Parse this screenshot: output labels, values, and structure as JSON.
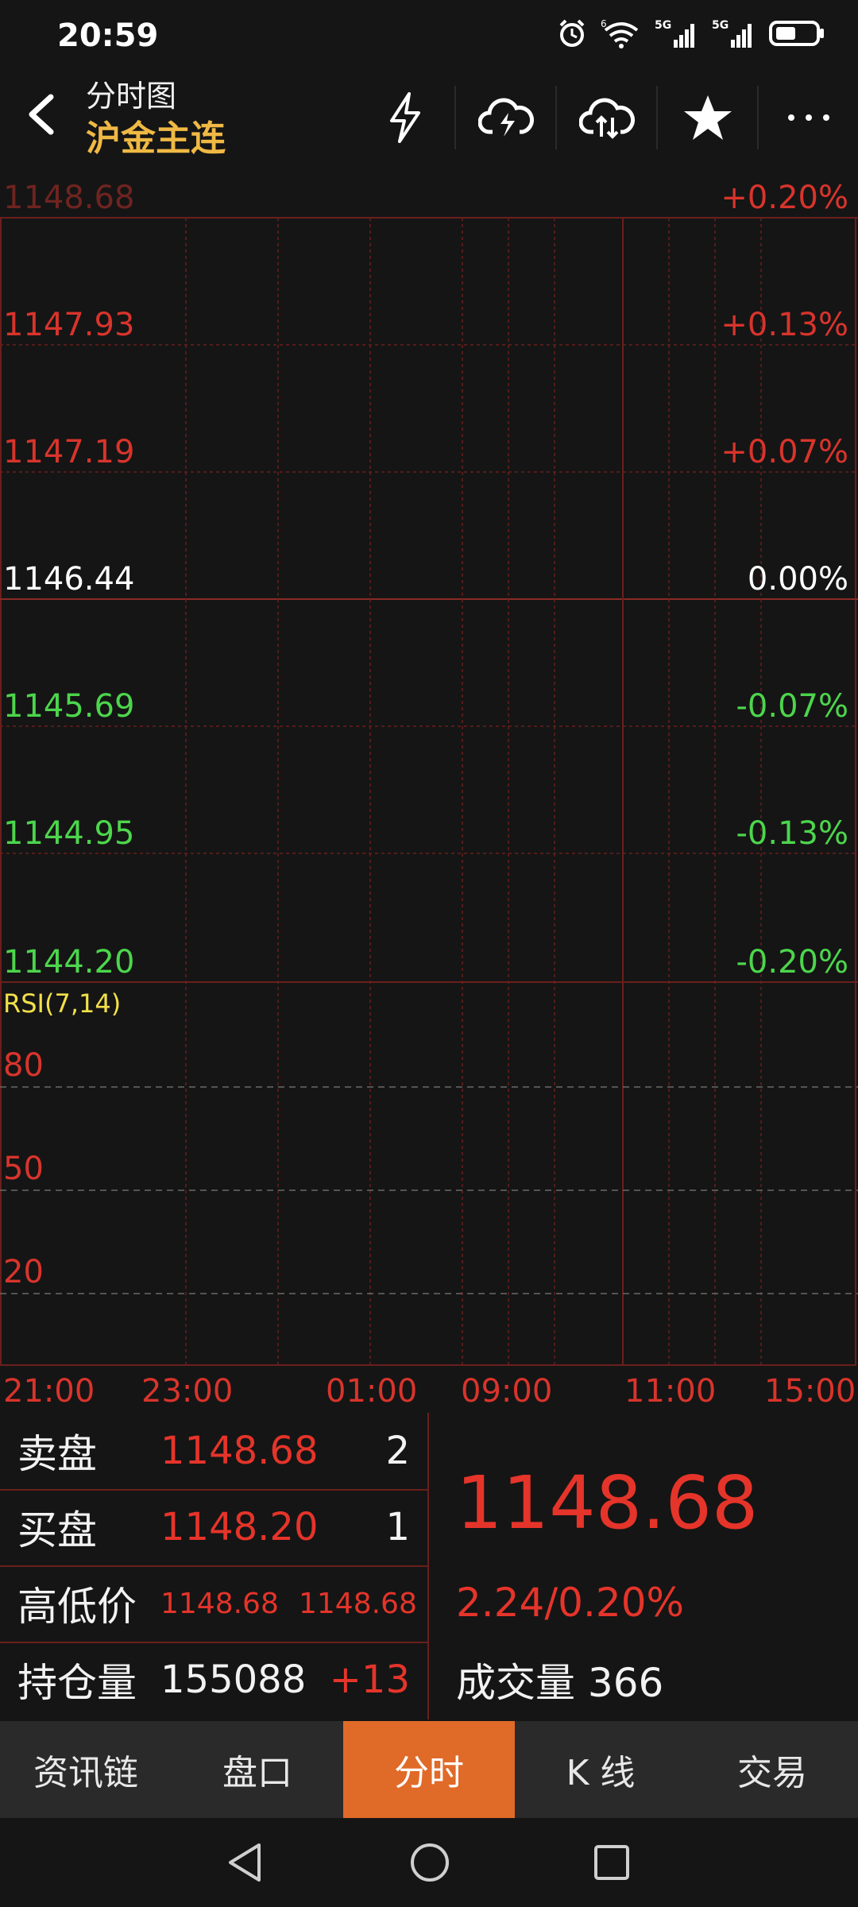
{
  "status_bar": {
    "time": "20:59",
    "net1": "5G",
    "net2": "5G",
    "wifi_sup": "6"
  },
  "header": {
    "subtitle": "分时图",
    "title": "沪金主连"
  },
  "header_icons": [
    "lightning-icon",
    "cloud-lightning-icon",
    "cloud-sync-icon",
    "star-icon",
    "more-icon"
  ],
  "chart": {
    "price_labels": [
      "1148.68",
      "1147.93",
      "1147.19",
      "1146.44",
      "1145.69",
      "1144.95",
      "1144.20"
    ],
    "pct_labels": [
      "+0.20%",
      "+0.13%",
      "+0.07%",
      "0.00%",
      "-0.07%",
      "-0.13%",
      "-0.20%"
    ],
    "rsi_label": "RSI(7,14)",
    "rsi_levels": [
      "80",
      "50",
      "20"
    ],
    "time_labels": [
      "21:00",
      "23:00",
      "01:00",
      "09:00",
      "11:00",
      "15:00"
    ],
    "colors": {
      "up": "#d8342c",
      "flat": "#ffffff",
      "down": "#4cd64c",
      "grid": "#6a1f1c"
    }
  },
  "chart_data": {
    "type": "line",
    "y_axis_left": [
      1148.68,
      1147.93,
      1147.19,
      1146.44,
      1145.69,
      1144.95,
      1144.2
    ],
    "y_axis_right_pct": [
      "+0.20%",
      "+0.13%",
      "+0.07%",
      "0.00%",
      "-0.07%",
      "-0.13%",
      "-0.20%"
    ],
    "x_ticks": [
      "21:00",
      "23:00",
      "01:00",
      "09:00",
      "11:00",
      "15:00"
    ],
    "ylim": [
      1144.2,
      1148.68
    ],
    "series": [],
    "rsi": {
      "label": "RSI(7,14)",
      "levels": [
        80,
        50,
        20
      ]
    }
  },
  "quote": {
    "sell": {
      "label": "卖盘",
      "price": "1148.68",
      "qty": "2"
    },
    "buy": {
      "label": "买盘",
      "price": "1148.20",
      "qty": "1"
    },
    "highlow": {
      "label": "高低价",
      "high": "1148.68",
      "low": "1148.68"
    },
    "oi": {
      "label": "持仓量",
      "value": "155088",
      "change": "+13"
    },
    "last_price": "1148.68",
    "change": "2.24/0.20%",
    "volume_label": "成交量",
    "volume": "366"
  },
  "tabs": [
    {
      "label": "资讯链"
    },
    {
      "label": "盘口"
    },
    {
      "label": "分时"
    },
    {
      "label": "K 线"
    },
    {
      "label": "交易"
    }
  ]
}
